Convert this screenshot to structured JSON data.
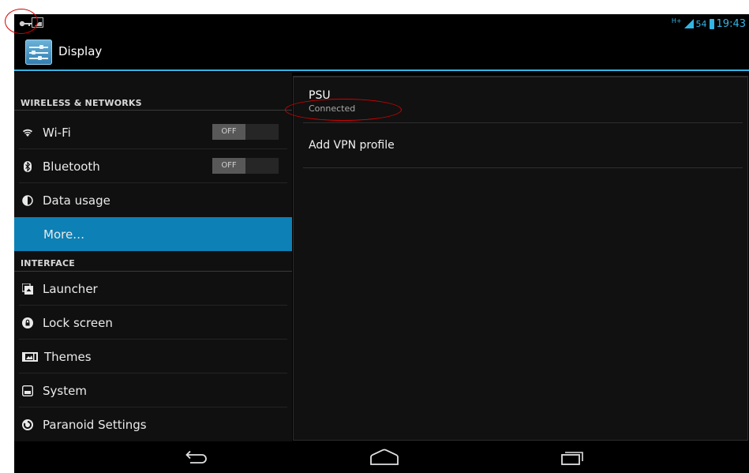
{
  "status_bar": {
    "left_icons": [
      "vpn-key-icon",
      "image-notification-icon"
    ],
    "network_type": "H+",
    "battery_level": "54",
    "time": "19:43",
    "colors": {
      "accent": "#33b5e5"
    }
  },
  "action_bar": {
    "app_icon": "display-settings-icon",
    "title": "Display"
  },
  "sidebar": {
    "headers": {
      "wireless": "WIRELESS & NETWORKS",
      "interface": "INTERFACE"
    },
    "items": [
      {
        "label": "Wi-Fi",
        "icon": "wifi-icon",
        "toggle": "OFF"
      },
      {
        "label": "Bluetooth",
        "icon": "bluetooth-icon",
        "toggle": "OFF"
      },
      {
        "label": "Data usage",
        "icon": "data-usage-icon"
      },
      {
        "label": "More…",
        "selected": true
      },
      {
        "label": "Launcher",
        "icon": "launcher-icon"
      },
      {
        "label": "Lock screen",
        "icon": "lock-screen-icon"
      },
      {
        "label": "Themes",
        "icon": "themes-icon"
      },
      {
        "label": "System",
        "icon": "system-icon"
      },
      {
        "label": "Paranoid Settings",
        "icon": "paranoid-settings-icon"
      }
    ],
    "selected_color": "#0d80b5"
  },
  "vpn": {
    "profile": {
      "name": "PSU",
      "status": "Connected"
    },
    "add_label": "Add VPN profile"
  },
  "nav_bar": {
    "buttons": [
      "back-icon",
      "home-icon",
      "recent-apps-icon"
    ]
  }
}
